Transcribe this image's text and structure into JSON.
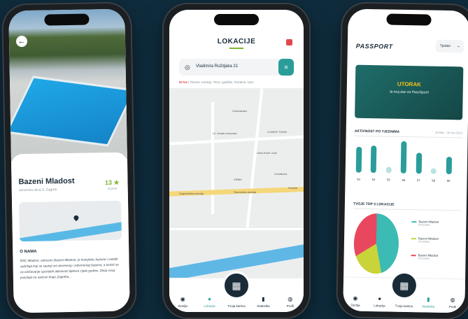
{
  "phone1": {
    "title": "Bazeni Mladost",
    "subtitle": "Jarunska ulica 5, Zagreb",
    "rating": "13 ★",
    "rating_label": "ocjena",
    "section": "O NAMA",
    "paragraph": "ŠRC Mladost, odnosno Bazeni Mladost, je kompleks bazena i ostalih sadržaja koji se sastoji od otvorenog i zatvorenog bazena, a koristi se za održavanje sportskih aktivnosti tijekom cijele godine. Zbog svog položaja na samom kraju Zagreba..."
  },
  "phone2": {
    "header": "LOKACIJE",
    "search_value": "Vladimira Ruždjaka 21",
    "distance": "50 km",
    "categories": "| Fitness, Kuhinja, Tenis, Igralište, Teretana, Gym",
    "map_labels": [
      "Vukovarska",
      "Ul. Grada vukovara",
      "LOWER TOWN",
      "Ulica Ruže Jurić",
      "Crnatkova",
      "VRBIK",
      "Zagrebačka avenija",
      "Slavonska avenija",
      "Savska"
    ],
    "nav": [
      "Zemlja",
      "Lokacije",
      "Tvoja kartica",
      "Statistika",
      "Profil"
    ]
  },
  "phone3": {
    "logo": "PASSPORT",
    "dropdown": "Tjedan",
    "banner_title": "UTORAK",
    "banner_sub": "Je tvoj dan za PassSport!",
    "activity_title": "AKTIVNOST PO TJEDNIMA",
    "activity_date": "19 May - 26 Jun 2023",
    "top3_title": "TVOJE TOP 3 LOKACIJE",
    "nav": [
      "Zemlja",
      "Lokacije",
      "Tvoja kartica",
      "Statistika",
      "Profil"
    ],
    "legend": [
      {
        "name": "Bazeni Mladost",
        "sub": "50 posjeta",
        "color": "#3bbbb4"
      },
      {
        "name": "Bazeni Mladost",
        "sub": "20 posjeta",
        "color": "#c9d33a"
      },
      {
        "name": "Bazeni Mladost",
        "sub": "35 posjeta",
        "color": "#e8475e"
      }
    ]
  },
  "chart_data": [
    {
      "type": "bar",
      "title": "AKTIVNOST PO TJEDNIMA",
      "categories": [
        "53",
        "54",
        "55",
        "56",
        "57",
        "58",
        "59"
      ],
      "values": [
        80,
        85,
        20,
        100,
        65,
        18,
        55
      ],
      "ylim": [
        0,
        100
      ]
    },
    {
      "type": "pie",
      "title": "TVOJE TOP 3 LOKACIJE",
      "categories": [
        "Bazeni Mladost",
        "Bazeni Mladost",
        "Bazeni Mladost"
      ],
      "values": [
        50,
        20,
        35
      ]
    }
  ]
}
